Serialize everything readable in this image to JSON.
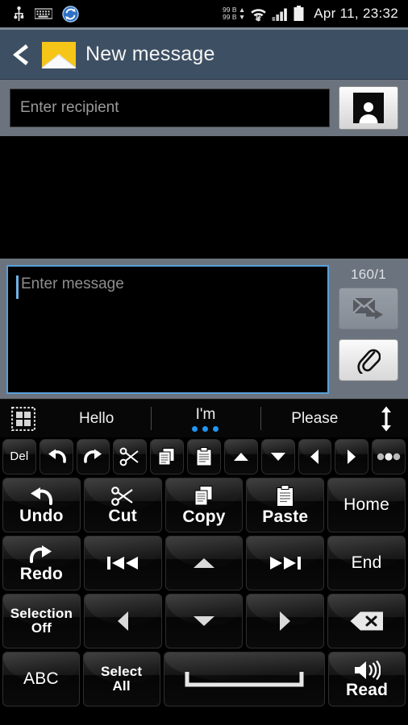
{
  "status_bar": {
    "icons": [
      "usb-icon",
      "keyboard-icon",
      "sync-icon"
    ],
    "data_up": "99 B",
    "data_down": "99 B",
    "network_icons": [
      "wifi-icon",
      "signal-icon",
      "battery-icon"
    ],
    "clock": "Apr 11, 23:32"
  },
  "action_bar": {
    "back_label": "Back",
    "app_icon": "envelope-icon",
    "title": "New message"
  },
  "recipient": {
    "placeholder": "Enter recipient",
    "value": "",
    "contacts_button": "contacts-icon"
  },
  "compose": {
    "placeholder": "Enter message",
    "value": "",
    "counter": "160/1",
    "send_label": "Send",
    "attach_label": "Attach"
  },
  "suggestion_bar": {
    "grid_icon": "grid-icon",
    "suggestions": [
      {
        "label": "Hello",
        "selected": false
      },
      {
        "label": "I'm",
        "selected": true
      },
      {
        "label": "Please",
        "selected": false
      }
    ],
    "expand_icon": "expand-vertical-icon",
    "dot_color": "#2196f3"
  },
  "keyboard": {
    "toolbar_row": [
      {
        "label": "Del",
        "icon": ""
      },
      {
        "label": "",
        "icon": "undo-icon"
      },
      {
        "label": "",
        "icon": "redo-icon"
      },
      {
        "label": "",
        "icon": "scissors-icon"
      },
      {
        "label": "",
        "icon": "copy-icon"
      },
      {
        "label": "",
        "icon": "paste-icon"
      },
      {
        "label": "",
        "icon": "arrow-up-icon"
      },
      {
        "label": "",
        "icon": "arrow-down-icon"
      },
      {
        "label": "",
        "icon": "arrow-left-icon"
      },
      {
        "label": "",
        "icon": "arrow-right-icon"
      },
      {
        "label": "",
        "icon": "more-dots-icon"
      }
    ],
    "row1": [
      {
        "label": "Undo",
        "icon": "undo-icon"
      },
      {
        "label": "Cut",
        "icon": "scissors-icon"
      },
      {
        "label": "Copy",
        "icon": "copy-icon"
      },
      {
        "label": "Paste",
        "icon": "paste-icon"
      },
      {
        "label": "Home",
        "icon": ""
      }
    ],
    "row2": [
      {
        "label": "Redo",
        "icon": "redo-icon"
      },
      {
        "label": "",
        "icon": "skip-back-icon"
      },
      {
        "label": "",
        "icon": "arrow-up-icon"
      },
      {
        "label": "",
        "icon": "skip-forward-icon"
      },
      {
        "label": "End",
        "icon": ""
      }
    ],
    "row3": [
      {
        "label": "Selection Off",
        "label_line1": "Selection",
        "label_line2": "Off",
        "icon": ""
      },
      {
        "label": "",
        "icon": "arrow-left-icon"
      },
      {
        "label": "",
        "icon": "arrow-down-icon"
      },
      {
        "label": "",
        "icon": "arrow-right-icon"
      },
      {
        "label": "",
        "icon": "backspace-icon"
      }
    ],
    "row4": [
      {
        "label": "ABC",
        "icon": ""
      },
      {
        "label": "Select All",
        "label_line1": "Select",
        "label_line2": "All",
        "icon": ""
      },
      {
        "label": "",
        "icon": "spacebar-icon"
      },
      {
        "label": "Read",
        "icon": "speaker-icon"
      }
    ]
  },
  "colors": {
    "action_bar": "#3d4f63",
    "recipient_bar": "#6b737e",
    "focus_border": "#59a0d8",
    "envelope": "#f5c518"
  }
}
